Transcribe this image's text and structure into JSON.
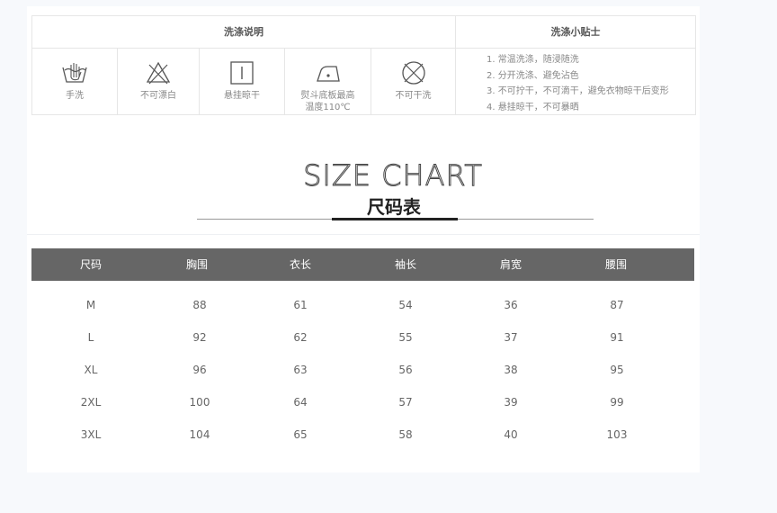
{
  "care": {
    "header_left": "洗涤说明",
    "header_right": "洗涤小贴士",
    "icons": [
      {
        "icon": "hand-wash-icon",
        "label": "手洗"
      },
      {
        "icon": "no-bleach-icon",
        "label": "不可漂白"
      },
      {
        "icon": "hang-dry-icon",
        "label": "悬挂晾干"
      },
      {
        "icon": "iron-icon",
        "label": "熨斗底板最高温度110℃"
      },
      {
        "icon": "no-dry-clean-icon",
        "label": "不可干洗"
      }
    ],
    "tips": [
      "1. 常温洗涤，随浸随洗",
      "2. 分开洗涤、避免沾色",
      "3. 不可拧干，不可滴干，避免衣物晾干后变形",
      "4. 悬挂晾干，不可暴晒"
    ]
  },
  "size_chart": {
    "title": "SIZE CHART",
    "subtitle": "尺码表",
    "columns": [
      "尺码",
      "胸围",
      "衣长",
      "袖长",
      "肩宽",
      "腰围"
    ],
    "rows": [
      [
        "M",
        "88",
        "61",
        "54",
        "36",
        "87"
      ],
      [
        "L",
        "92",
        "62",
        "55",
        "37",
        "91"
      ],
      [
        "XL",
        "96",
        "63",
        "56",
        "38",
        "95"
      ],
      [
        "2XL",
        "100",
        "64",
        "57",
        "39",
        "99"
      ],
      [
        "3XL",
        "104",
        "65",
        "58",
        "40",
        "103"
      ]
    ]
  },
  "colors": {
    "table_header_bg": "#666666",
    "text": "#666666",
    "page_bg": "#f7f9fc"
  }
}
